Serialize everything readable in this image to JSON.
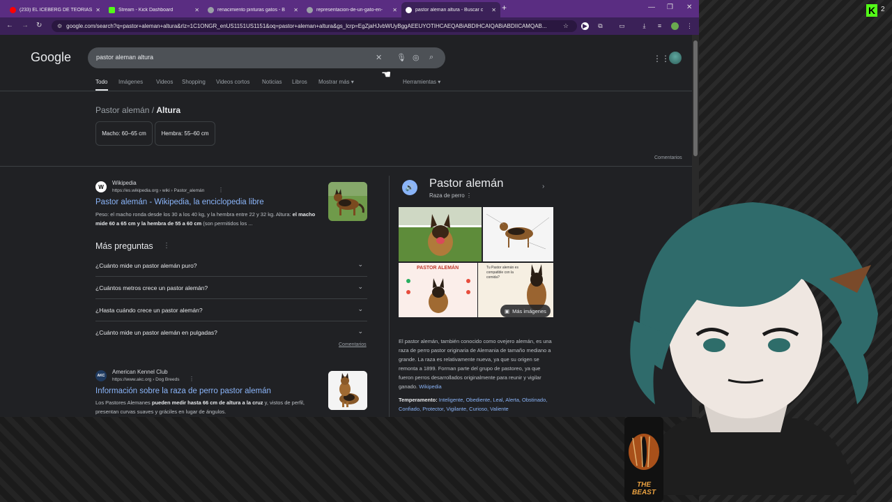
{
  "browser": {
    "tabs": [
      {
        "title": "(233) EL ICEBERG DE TEORÍAS C",
        "favicon_color": "#ff0000",
        "active": false
      },
      {
        "title": "Stream - Kick Dashboard",
        "favicon_color": "#53fc18",
        "active": false
      },
      {
        "title": "renacimiento pinturas gatos - B",
        "favicon_color": "#9aa0a6",
        "active": false
      },
      {
        "title": "representacion-de-un-gato-en-",
        "favicon_color": "#9aa0a6",
        "active": false
      },
      {
        "title": "pastor aleman altura - Buscar c",
        "favicon_color": "#9aa0a6",
        "active": true
      }
    ],
    "url": "google.com/search?q=pastor+aleman+altura&rlz=1C1ONGR_enUS1151US1151&oq=pastor+aleman+altura&gs_lcrp=EgZjaHJvbWUyBggAEEUYOTIHCAEQABiABDIHCAIQABiABDIICAMQAB..."
  },
  "google": {
    "logo": "Google",
    "query": "pastor aleman altura",
    "tabs": [
      "Todo",
      "Imágenes",
      "Videos",
      "Shopping",
      "Videos cortos",
      "Noticias",
      "Libros",
      "Mostrar más"
    ],
    "tools": "Herramientas",
    "crumb": {
      "prefix": "Pastor alemán",
      "sep": " / ",
      "current": "Altura"
    },
    "chips": [
      "Macho: 60–65 cm",
      "Hembra: 55–60 cm"
    ],
    "comentarios": "Comentarios",
    "result1": {
      "source": "Wikipedia",
      "url": "https://es.wikipedia.org › wiki › Pastor_alemán",
      "title": "Pastor alemán - Wikipedia, la enciclopedia libre",
      "snippet_a": "Peso: el macho ronda desde los 30 a los 40 kg, y la hembra entre 22 y 32 kg. Altura: ",
      "snippet_b": "el macho mide 60 a 65 cm y la hembra de 55 a 60 cm",
      "snippet_c": " (son permitidos los ..."
    },
    "paa": {
      "title": "Más preguntas",
      "questions": [
        "¿Cuánto mide un pastor alemán puro?",
        "¿Cuántos metros crece un pastor alemán?",
        "¿Hasta cuándo crece un pastor alemán?",
        "¿Cuánto mide un pastor alemán en pulgadas?"
      ],
      "feedback": "Comentarios"
    },
    "result2": {
      "source": "American Kennel Club",
      "logo": "AKC",
      "url": "https://www.akc.org › Dog Breeds",
      "title": "Información sobre la raza de perro pastor alemán",
      "snippet_a": "Los Pastores Alemanes ",
      "snippet_b": "pueden medir hasta 66 cm de altura a la cruz",
      "snippet_c": " y, vistos de perfil, presentan curvas suaves y gráciles en lugar de ángulos."
    },
    "knowledge_panel": {
      "title": "Pastor alemán",
      "subtitle": "Raza de perro",
      "image_label_1": "PASTOR ALEMÁN",
      "image_label_2": "Tu Pastor alemán es compatible con la comida?",
      "more_images": "Más imágenes",
      "description": "El pastor alemán, también conocido como ovejero alemán, es una raza de perro pastor originaria de Alemania de tamaño mediano a grande. La raza es relativamente nueva, ya que su origen se remonta a 1899. Forman parte del grupo de pastoreo, ya que fueron perros desarrollados originalmente para reunir y vigilar ganado. ",
      "description_link": "Wikipedia",
      "temperament_label": "Temperamento:",
      "temperament": " Inteligente, Obediente, Leal, Alerta, Obstinado, Confiado, Protector, Vigilante, Curioso, Valiente"
    }
  },
  "overlay": {
    "kick_letter": "K",
    "viewer_count": "2",
    "can_text": "THE BEAST"
  }
}
